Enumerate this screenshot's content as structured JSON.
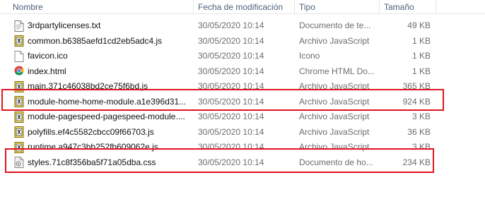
{
  "columns": {
    "name": "Nombre",
    "date": "Fecha de modificación",
    "type": "Tipo",
    "size": "Tamaño"
  },
  "files": [
    {
      "name": "3rdpartylicenses.txt",
      "date": "30/05/2020 10:14",
      "type": "Documento de te...",
      "size": "49 KB",
      "icon": "text-file-icon",
      "highlighted": false
    },
    {
      "name": "common.b6385aefd1cd2eb5adc4.js",
      "date": "30/05/2020 10:14",
      "type": "Archivo JavaScript",
      "size": "1 KB",
      "icon": "javascript-file-icon",
      "highlighted": false
    },
    {
      "name": "favicon.ico",
      "date": "30/05/2020 10:14",
      "type": "Icono",
      "size": "1 KB",
      "icon": "ico-file-icon",
      "highlighted": false
    },
    {
      "name": "index.html",
      "date": "30/05/2020 10:14",
      "type": "Chrome HTML Do...",
      "size": "1 KB",
      "icon": "chrome-html-icon",
      "highlighted": false
    },
    {
      "name": "main.371c46038bd2ce75f6bd.js",
      "date": "30/05/2020 10:14",
      "type": "Archivo JavaScript",
      "size": "365 KB",
      "icon": "javascript-file-icon",
      "highlighted": false
    },
    {
      "name": "module-home-home-module.a1e396d31...",
      "date": "30/05/2020 10:14",
      "type": "Archivo JavaScript",
      "size": "924 KB",
      "icon": "javascript-file-icon",
      "highlighted": true
    },
    {
      "name": "module-pagespeed-pagespeed-module....",
      "date": "30/05/2020 10:14",
      "type": "Archivo JavaScript",
      "size": "3 KB",
      "icon": "javascript-file-icon",
      "highlighted": false
    },
    {
      "name": "polyfills.ef4c5582cbcc09f66703.js",
      "date": "30/05/2020 10:14",
      "type": "Archivo JavaScript",
      "size": "36 KB",
      "icon": "javascript-file-icon",
      "highlighted": false
    },
    {
      "name": "runtime.a947c3bb252fb609062e.js",
      "date": "30/05/2020 10:14",
      "type": "Archivo JavaScript",
      "size": "3 KB",
      "icon": "javascript-file-icon",
      "highlighted": false
    },
    {
      "name": "styles.71c8f356ba5f71a05dba.css",
      "date": "30/05/2020 10:14",
      "type": "Documento de ho...",
      "size": "234 KB",
      "icon": "css-file-icon",
      "highlighted": true
    }
  ],
  "colors": {
    "highlight": "#e0141e",
    "header_text": "#4c607a",
    "secondary_text": "#6d6d6d"
  }
}
